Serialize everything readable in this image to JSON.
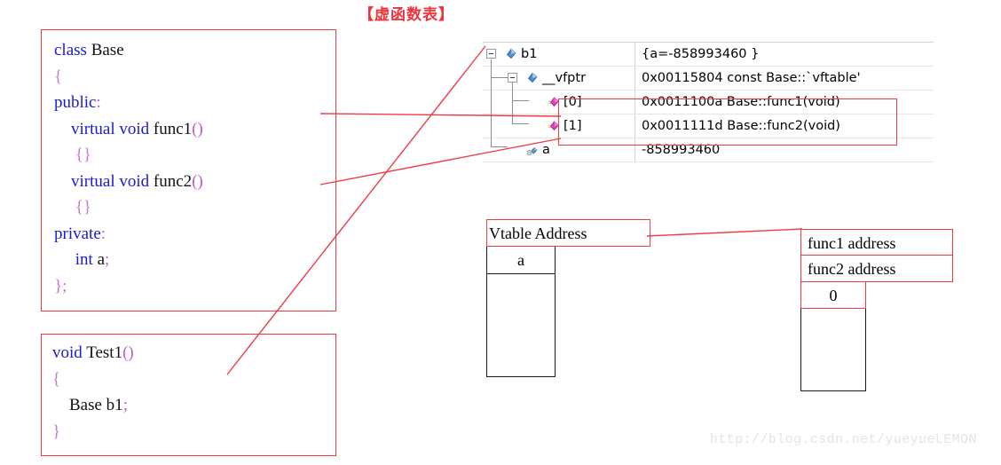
{
  "title": "【虚函数表】",
  "class_code": {
    "name": "class-definition-code",
    "lines": [
      [
        {
          "t": "class ",
          "c": "kw"
        },
        {
          "t": "Base",
          "c": "id"
        }
      ],
      [
        {
          "t": "{",
          "c": "brace"
        }
      ],
      [
        {
          "t": "public",
          "c": "kw"
        },
        {
          "t": ":",
          "c": "punc"
        }
      ],
      [
        {
          "t": "    ",
          "c": "id"
        },
        {
          "t": "virtual void ",
          "c": "kw"
        },
        {
          "t": "func1",
          "c": "id"
        },
        {
          "t": "()",
          "c": "punc"
        }
      ],
      [
        {
          "t": "     ",
          "c": "id"
        },
        {
          "t": "{}",
          "c": "brace"
        }
      ],
      [
        {
          "t": "    ",
          "c": "id"
        },
        {
          "t": "virtual void ",
          "c": "kw"
        },
        {
          "t": "func2",
          "c": "id"
        },
        {
          "t": "()",
          "c": "punc"
        }
      ],
      [
        {
          "t": "     ",
          "c": "id"
        },
        {
          "t": "{}",
          "c": "brace"
        }
      ],
      [
        {
          "t": "private",
          "c": "kw"
        },
        {
          "t": ":",
          "c": "punc"
        }
      ],
      [
        {
          "t": "     ",
          "c": "id"
        },
        {
          "t": "int ",
          "c": "kw"
        },
        {
          "t": "a",
          "c": "id"
        },
        {
          "t": ";",
          "c": "punc"
        }
      ],
      [
        {
          "t": "};",
          "c": "brace"
        }
      ]
    ]
  },
  "test_code": {
    "name": "test-function-code",
    "lines": [
      [
        {
          "t": "void ",
          "c": "kw"
        },
        {
          "t": "Test1",
          "c": "id"
        },
        {
          "t": "()",
          "c": "punc"
        }
      ],
      [
        {
          "t": "{",
          "c": "brace"
        }
      ],
      [
        {
          "t": "    ",
          "c": "id"
        },
        {
          "t": "Base b1",
          "c": "id"
        },
        {
          "t": ";",
          "c": "punc"
        }
      ],
      [
        {
          "t": "}",
          "c": "brace"
        }
      ]
    ]
  },
  "watch": {
    "rows": [
      {
        "label": "b1",
        "value": "{a=-858993460 }",
        "icon": "field-diamond-blue-icon",
        "indent": 0,
        "expander": true
      },
      {
        "label": "__vfptr",
        "value": "0x00115804 const Base::`vftable'",
        "icon": "field-diamond-blue-icon",
        "indent": 1,
        "expander": true
      },
      {
        "label": "[0]",
        "value": "0x0011100a Base::func1(void)",
        "icon": "array-element-diamond-magenta-icon",
        "indent": 2,
        "expander": false
      },
      {
        "label": "[1]",
        "value": "0x0011111d Base::func2(void)",
        "icon": "array-element-diamond-magenta-icon",
        "indent": 2,
        "expander": false
      },
      {
        "label": "a",
        "value": "-858993460",
        "icon": "private-field-icon",
        "indent": 1,
        "expander": false
      }
    ]
  },
  "object_box": {
    "name": "object-memory-layout",
    "cells": [
      {
        "text": "Vtable Address",
        "style": "vtable"
      },
      {
        "text": "a",
        "style": "a"
      },
      {
        "text": "",
        "style": "empty"
      }
    ]
  },
  "vtable_box": {
    "name": "virtual-function-table",
    "cells": [
      {
        "text": "func1 address",
        "style": "f1"
      },
      {
        "text": "func2 address",
        "style": "f2"
      },
      {
        "text": "0",
        "style": "zero"
      },
      {
        "text": "",
        "style": "empty"
      }
    ]
  },
  "watermark": "http://blog.csdn.net/yueyueLEMON",
  "colors": {
    "accent_red": "#ef3b45",
    "keyword_blue": "#1919d6",
    "brace_pink": "#c878c8",
    "tree_line": "#8c8c8c",
    "watermark_gray": "#e4e4e4"
  }
}
